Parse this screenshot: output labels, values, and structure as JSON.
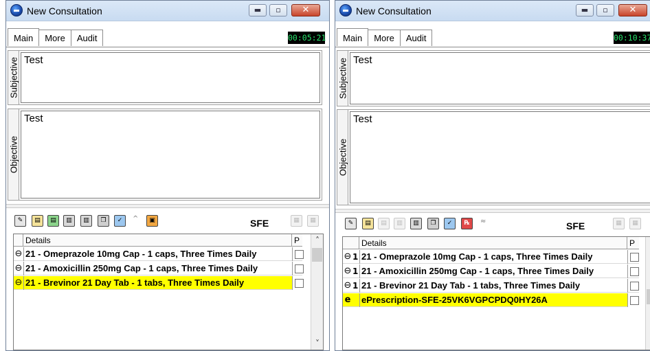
{
  "window_left": {
    "title": "New Consultation",
    "tabs": [
      "Main",
      "More",
      "Audit"
    ],
    "timer": "00:05:21",
    "subjective_label": "Subjective",
    "subjective_text": "Test",
    "objective_label": "Objective",
    "objective_text": "Test",
    "sfe_label": "SFE",
    "grid_header": {
      "details": "Details",
      "p": "P"
    },
    "rows": [
      {
        "icon": "pill-icon",
        "text": "21 - Omeprazole 10mg Cap - 1 caps, Three Times Daily",
        "selected": false
      },
      {
        "icon": "pill-icon",
        "text": "21 - Amoxicillin 250mg Cap - 1 caps, Three Times Daily",
        "selected": false
      },
      {
        "icon": "pill-icon",
        "text": "21 - Brevinor 21 Day Tab - 1 tabs, Three Times Daily",
        "selected": true
      }
    ]
  },
  "window_right": {
    "title": "New Consultation",
    "tabs": [
      "Main",
      "More",
      "Audit"
    ],
    "timer": "00:10:37",
    "subjective_label": "Subjective",
    "subjective_text": "Test",
    "objective_label": "Objective",
    "objective_text": "Test",
    "sfe_label": "SFE",
    "grid_header": {
      "details": "Details",
      "p": "P"
    },
    "rows": [
      {
        "icon": "pill-icon",
        "num": "1",
        "text": "21 - Omeprazole 10mg Cap - 1 caps, Three Times Daily",
        "selected": false
      },
      {
        "icon": "pill-icon",
        "num": "1",
        "text": "21 - Amoxicillin 250mg Cap - 1 caps, Three Times Daily",
        "selected": false
      },
      {
        "icon": "pill-icon",
        "num": "1",
        "text": "21 - Brevinor 21 Day Tab - 1 tabs, Three Times Daily",
        "selected": false
      },
      {
        "icon": "eprescription-icon",
        "icon_glyph": "e",
        "text": "ePrescription-SFE-25VK6VGPCPDQ0HY26A",
        "selected": true
      }
    ]
  },
  "colors": {
    "selection": "#ffff00",
    "timer_text": "#28e36c",
    "titlebar": "#c8dbf1"
  }
}
